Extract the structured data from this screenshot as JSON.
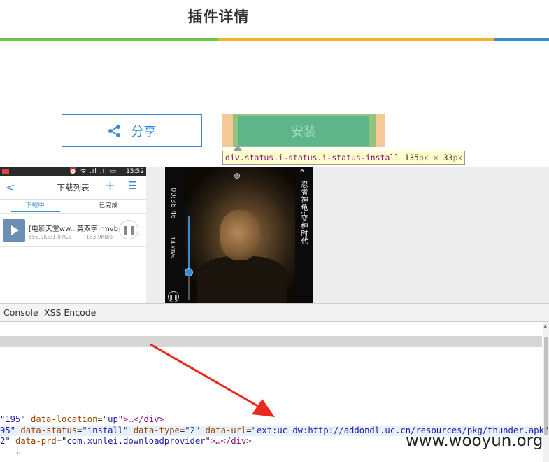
{
  "header": {
    "title": "插件详情",
    "bar_colors": [
      "#6cc644",
      "#f0b429",
      "#3b8bd0"
    ]
  },
  "actions": {
    "share_label": "分享",
    "install_label": "安装"
  },
  "inspector_tooltip": {
    "selector": "div.status.i-status.i-status-install",
    "width": "135",
    "height": "33",
    "unit": "px",
    "times": "×"
  },
  "phone_screenshot": {
    "status_time": "15:52",
    "status_icons": "⏰ ᯤ .ıl .ıl ▭",
    "list_title": "下载列表",
    "tabs": [
      "下载中",
      "已完成"
    ],
    "file": {
      "name": "[电影天堂ww...英双字.rmvb",
      "progress": "556.0KB/1.07GB",
      "speed": "183.9KB/s"
    }
  },
  "video_screenshot": {
    "time": "00:36:46",
    "rate": "14 KB/s",
    "title": "忍者神龟:变种时代"
  },
  "devtools": {
    "tabs": [
      "Console",
      "XSS Encode"
    ],
    "lines": [
      {
        "pre": "\"195\" ",
        "attr1": "data-location",
        "eq1": "=\"",
        "val1": "up",
        "end": "\">…</div>"
      },
      {
        "pre": "95\" ",
        "attr1": "data-status",
        "val1": "install",
        "attr2": "data-type",
        "val2": "2",
        "attr3": "data-url",
        "val3": "ext:uc_dw:http://addondl.uc.cn/resources/pkg/thunder.apk"
      },
      {
        "pre": "2\" ",
        "attr1": "data-prd",
        "val1": "com.xunlei.downloadprovider",
        "end": "\">…</div>"
      }
    ],
    "dots": "''"
  },
  "watermark": "www.wooyun.org"
}
